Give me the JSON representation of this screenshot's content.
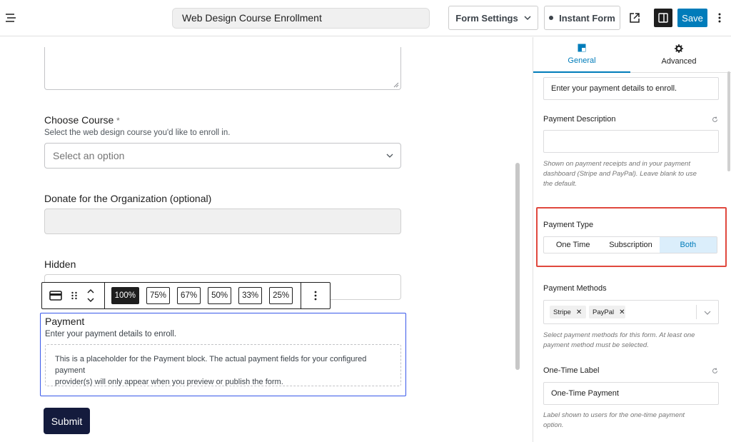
{
  "header": {
    "form_title": "Web Design Course Enrollment",
    "form_settings_label": "Form Settings",
    "instant_form_label": "Instant Form",
    "save_label": "Save"
  },
  "canvas": {
    "choose_course": {
      "label": "Choose Course",
      "required_mark": "*",
      "help": "Select the web design course you'd like to enroll in.",
      "placeholder": "Select an option"
    },
    "donate": {
      "label": "Donate for the Organization (optional)"
    },
    "hidden": {
      "label": "Hidden"
    },
    "toolbar": {
      "widths": [
        "100%",
        "75%",
        "67%",
        "50%",
        "33%",
        "25%"
      ],
      "active_width": "100%"
    },
    "payment": {
      "label": "Payment",
      "help": "Enter your payment details to enroll.",
      "placeholder_line1": "This is a placeholder for the Payment block. The actual payment fields for your configured payment",
      "placeholder_line2": "provider(s) will only appear when you preview or publish the form."
    },
    "submit_label": "Submit"
  },
  "panel": {
    "tabs": {
      "general": "General",
      "advanced": "Advanced"
    },
    "description_value": "Enter your payment details to enroll.",
    "payment_description": {
      "label": "Payment Description",
      "value": "",
      "help_line1": "Shown on payment receipts and in your payment",
      "help_line2": "dashboard (Stripe and PayPal). Leave blank to use",
      "help_line3": "the default."
    },
    "payment_type": {
      "label": "Payment Type",
      "options": [
        "One Time",
        "Subscription",
        "Both"
      ],
      "selected": "Both"
    },
    "payment_methods": {
      "label": "Payment Methods",
      "selected": [
        "Stripe",
        "PayPal"
      ],
      "help_line1": "Select payment methods for this form. At least one",
      "help_line2": "payment method must be selected."
    },
    "one_time_label": {
      "label": "One-Time Label",
      "value": "One-Time Payment",
      "help_line1": "Label shown to users for the one-time payment",
      "help_line2": "option."
    }
  },
  "colors": {
    "accent": "#007cba",
    "selection": "#3858e9",
    "highlight": "#e0483e",
    "submit": "#141b3d"
  }
}
